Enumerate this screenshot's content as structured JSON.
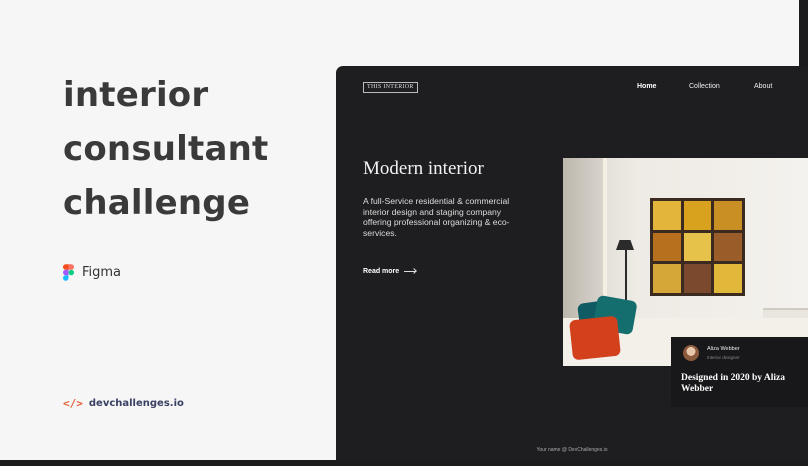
{
  "intro": {
    "title_lines": [
      "interior",
      "consultant",
      "challenge"
    ],
    "tool": {
      "icon": "figma-icon",
      "label": "Figma"
    },
    "brand": {
      "icon_text": "</>",
      "label": "devchallenges.io"
    }
  },
  "preview": {
    "logo": "THIS INTERIOR",
    "nav": [
      {
        "label": "Home",
        "active": true
      },
      {
        "label": "Collection",
        "active": false
      },
      {
        "label": "About",
        "active": false
      }
    ],
    "hero": {
      "title": "Modern interior",
      "description": "A full-Service residential & commercial interior design and staging company offering professional organizing & eco-services.",
      "cta": "Read more"
    },
    "designer": {
      "name": "Aliza Webber",
      "role": "Interior designer",
      "credit": "Designed in 2020 by Aliza Webber"
    },
    "footer": "Your name @ DevChallenges.io"
  },
  "colors": {
    "background": "#f6f6f6",
    "dark_panel": "#1e1e20",
    "accent": "#e0603a",
    "brand_text": "#3a3f63"
  }
}
